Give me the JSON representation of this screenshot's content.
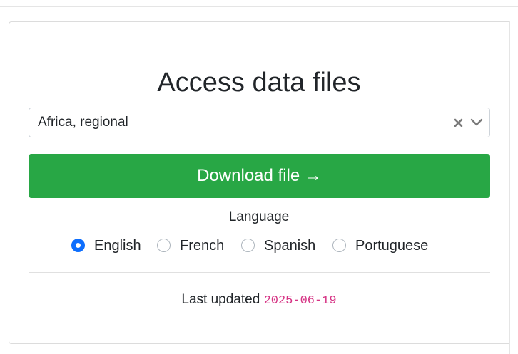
{
  "page": {
    "title": "Access data files"
  },
  "region_select": {
    "value": "Africa, regional",
    "clear_icon": "close-icon",
    "toggle_icon": "chevron-down-icon"
  },
  "download_button": {
    "label": "Download file →",
    "color": "#28a745"
  },
  "language": {
    "label": "Language",
    "options": [
      {
        "label": "English",
        "selected": true
      },
      {
        "label": "French",
        "selected": false
      },
      {
        "label": "Spanish",
        "selected": false
      },
      {
        "label": "Portuguese",
        "selected": false
      }
    ],
    "selected_color": "#0d6efd"
  },
  "footer": {
    "updated_label": "Last updated",
    "updated_date": "2025-06-19",
    "date_color": "#d63384"
  }
}
